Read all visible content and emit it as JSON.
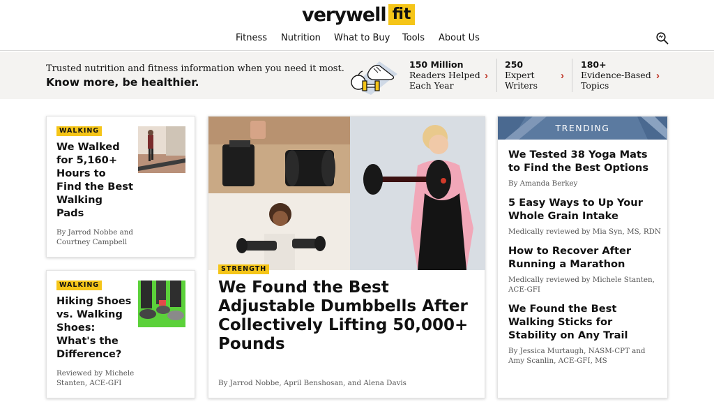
{
  "site": {
    "logo_text": "verywell",
    "logo_badge": "fit",
    "brand_yellow": "#f5c518",
    "accent_red": "#c0392b"
  },
  "nav": {
    "items": [
      "Fitness",
      "Nutrition",
      "What to Buy",
      "Tools",
      "About Us"
    ],
    "search_icon": "search-icon"
  },
  "banner": {
    "line1": "Trusted nutrition and fitness information when you need it most.",
    "line2": "Know more, be healthier.",
    "stats": [
      {
        "number": "150 Million",
        "label1": "Readers Helped",
        "label2": "Each Year"
      },
      {
        "number": "250",
        "label1": "Expert",
        "label2": "Writers"
      },
      {
        "number": "180+",
        "label1": "Evidence-Based",
        "label2": "Topics"
      }
    ]
  },
  "cards": [
    {
      "tag": "WALKING",
      "title": "We Walked for 5,160+ Hours to Find the Best Walking Pads",
      "byline": "By Jarrod Nobbe and Courtney Campbell"
    },
    {
      "tag": "WALKING",
      "title": "Hiking Shoes vs. Walking Shoes: What's the Difference?",
      "byline": "Reviewed by Michele Stanten, ACE-GFI"
    }
  ],
  "feature": {
    "tag": "STRENGTH",
    "title": "We Found the Best Adjustable Dumbbells After Collectively Lifting 50,000+ Pounds",
    "byline": "By Jarrod Nobbe, April Benshosan, and Alena Davis"
  },
  "trending": {
    "header": "TRENDING",
    "header_color": "#5b7aa0",
    "items": [
      {
        "title": "We Tested 38 Yoga Mats to Find the Best Options",
        "byline": "By Amanda Berkey"
      },
      {
        "title": "5 Easy Ways to Up Your Whole Grain Intake",
        "byline": "Medically reviewed by Mia Syn, MS, RDN"
      },
      {
        "title": "How to Recover After Running a Marathon",
        "byline": "Medically reviewed by Michele Stanten, ACE-GFI"
      },
      {
        "title": "We Found the Best Walking Sticks for Stability on Any Trail",
        "byline": "By Jessica Murtaugh, NASM-CPT and Amy Scanlin, ACE-GFI, MS"
      }
    ]
  }
}
